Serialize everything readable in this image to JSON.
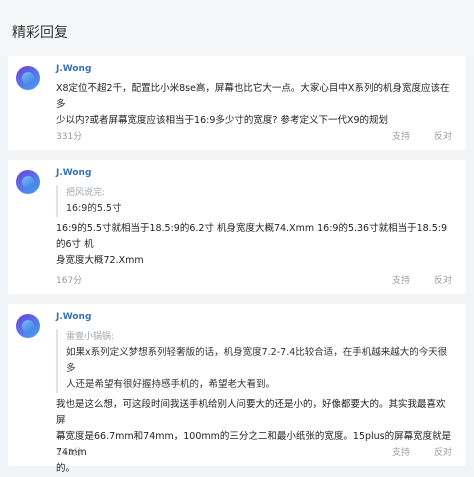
{
  "page": {
    "title": "精彩回复"
  },
  "replies": [
    {
      "user": "J.Wong",
      "lines": [
        "X8定位不超2千，配置比小米8se高，屏幕也比它大一点。大家心目中X系列的机身宽度应该在多",
        "少以内?或者屏幕宽度应该相当于16:9多少寸的宽度? 参考定义下一代X9的规划"
      ],
      "views": "331分",
      "support": "支持",
      "oppose": "反对"
    },
    {
      "user": "J.Wong",
      "quote": {
        "name": "把风说完:",
        "text": "16:9的5.5寸"
      },
      "lines": [
        "16:9的5.5寸就相当于18.5:9的6.2寸 机身宽度大概74.Xmm 16:9的5.36寸就相当于18.5:9的6寸 机",
        "身宽度大概72.Xmm"
      ],
      "views": "167分",
      "support": "支持",
      "oppose": "反对"
    },
    {
      "user": "J.Wong",
      "quote": {
        "name": "雷壹小锅锅:",
        "lines": [
          "如果x系列定义梦想系列轻奢版的话，机身宽度7.2-7.4比较合适，在手机越来越大的今天很多",
          "人还是希望有很好握持感手机的，希望老大看到。"
        ]
      },
      "lines": [
        "我也是这么想，可这段时间我送手机给别人问要大的还是小的，好像都要大的。其实我最喜欢屏",
        "幕宽度是66.7mm和74mm，100mm的三分之二和最小纸张的宽度。15plus的屏幕宽度就是74mm",
        "的。"
      ],
      "views": "173分",
      "support": "支持",
      "oppose": "反对"
    }
  ]
}
